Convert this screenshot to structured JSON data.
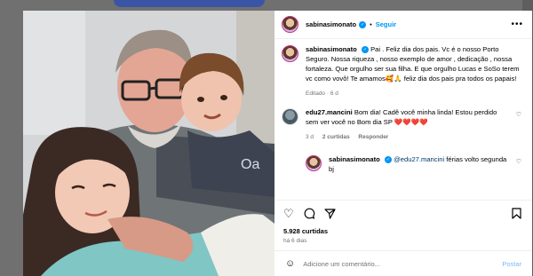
{
  "header": {
    "username": "sabinasimonato",
    "verified_icon": "verified-badge-icon",
    "follow_label": "Seguir",
    "more_icon": "ellipsis-icon"
  },
  "caption": {
    "username": "sabinasimonato",
    "text": "Pai . Feliz dia dos pais. Vc é o nosso Porto Seguro. Nossa riqueza , nosso exemplo de amor , dedicação , nossa fortaleza. Que orgulho ser sua filha. E que orgulho Lucas e SoSo terem vc como vovô! Te amamos🥰🙏 feliz dia dos pais pra todos os papais!",
    "edited": "Editado · 6 d"
  },
  "comments": [
    {
      "username": "edu27.mancini",
      "text_a": "Bom dia! Cadê você minha linda! Estou perdido sem ver você no Bom dia SP",
      "text_hearts": "❤️❤️❤️❤️",
      "time": "3 d",
      "likes": "2 curtidas",
      "reply_label": "Responder"
    },
    {
      "username": "sabinasimonato",
      "mention": "@edu27.mancini",
      "text": "férias volto segunda bj"
    }
  ],
  "actions": {
    "like_icon": "heart-icon",
    "comment_icon": "comment-icon",
    "share_icon": "share-icon",
    "save_icon": "bookmark-icon"
  },
  "likes": "5.928 curtidas",
  "posted": "há 6 dias",
  "add_comment": {
    "emoji_icon": "emoji-icon",
    "placeholder": "Adicione um comentário...",
    "post_label": "Postar"
  }
}
